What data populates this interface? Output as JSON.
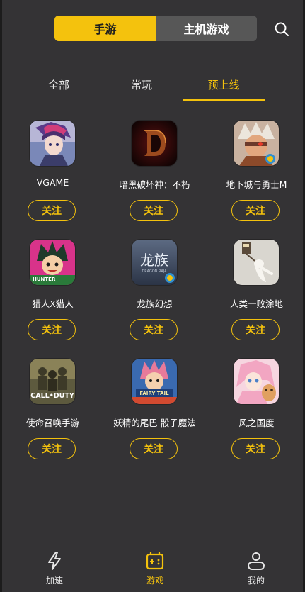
{
  "top_switch": {
    "mobile_label": "手游",
    "console_label": "主机游戏"
  },
  "tabs": [
    {
      "label": "全部"
    },
    {
      "label": "常玩"
    },
    {
      "label": "预上线"
    }
  ],
  "active_tab": "预上线",
  "games": [
    {
      "name": "VGAME",
      "follow_label": "关注",
      "icon": "anime-character-icon"
    },
    {
      "name": "暗黑破坏神：不朽",
      "follow_label": "关注",
      "icon": "diablo-d-icon"
    },
    {
      "name": "地下城与勇士M",
      "follow_label": "关注",
      "icon": "warrior-character-icon"
    },
    {
      "name": "猎人X猎人",
      "follow_label": "关注",
      "icon": "hunter-boy-icon"
    },
    {
      "name": "龙族幻想",
      "follow_label": "关注",
      "icon": "dragon-logo-icon"
    },
    {
      "name": "人类一败涂地",
      "follow_label": "关注",
      "icon": "ragdoll-icon"
    },
    {
      "name": "使命召唤手游",
      "follow_label": "关注",
      "icon": "soldiers-icon"
    },
    {
      "name": "妖精的尾巴 骰子魔法",
      "follow_label": "关注",
      "icon": "fairy-tail-icon"
    },
    {
      "name": "风之国度",
      "follow_label": "关注",
      "icon": "anime-girl-icon"
    }
  ],
  "icon_text": {
    "cod": "CALL•DUTY",
    "dragon": "龙族",
    "dragon_sub": "DRAGON RAJA",
    "hunter": "HUNTER",
    "fairy": "FAIRY TAIL"
  },
  "bottom_nav": [
    {
      "label": "加速",
      "icon": "lightning-icon"
    },
    {
      "label": "游戏",
      "icon": "gamepad-icon"
    },
    {
      "label": "我的",
      "icon": "user-icon"
    }
  ],
  "colors": {
    "accent": "#f4c20d",
    "background": "#343335"
  }
}
